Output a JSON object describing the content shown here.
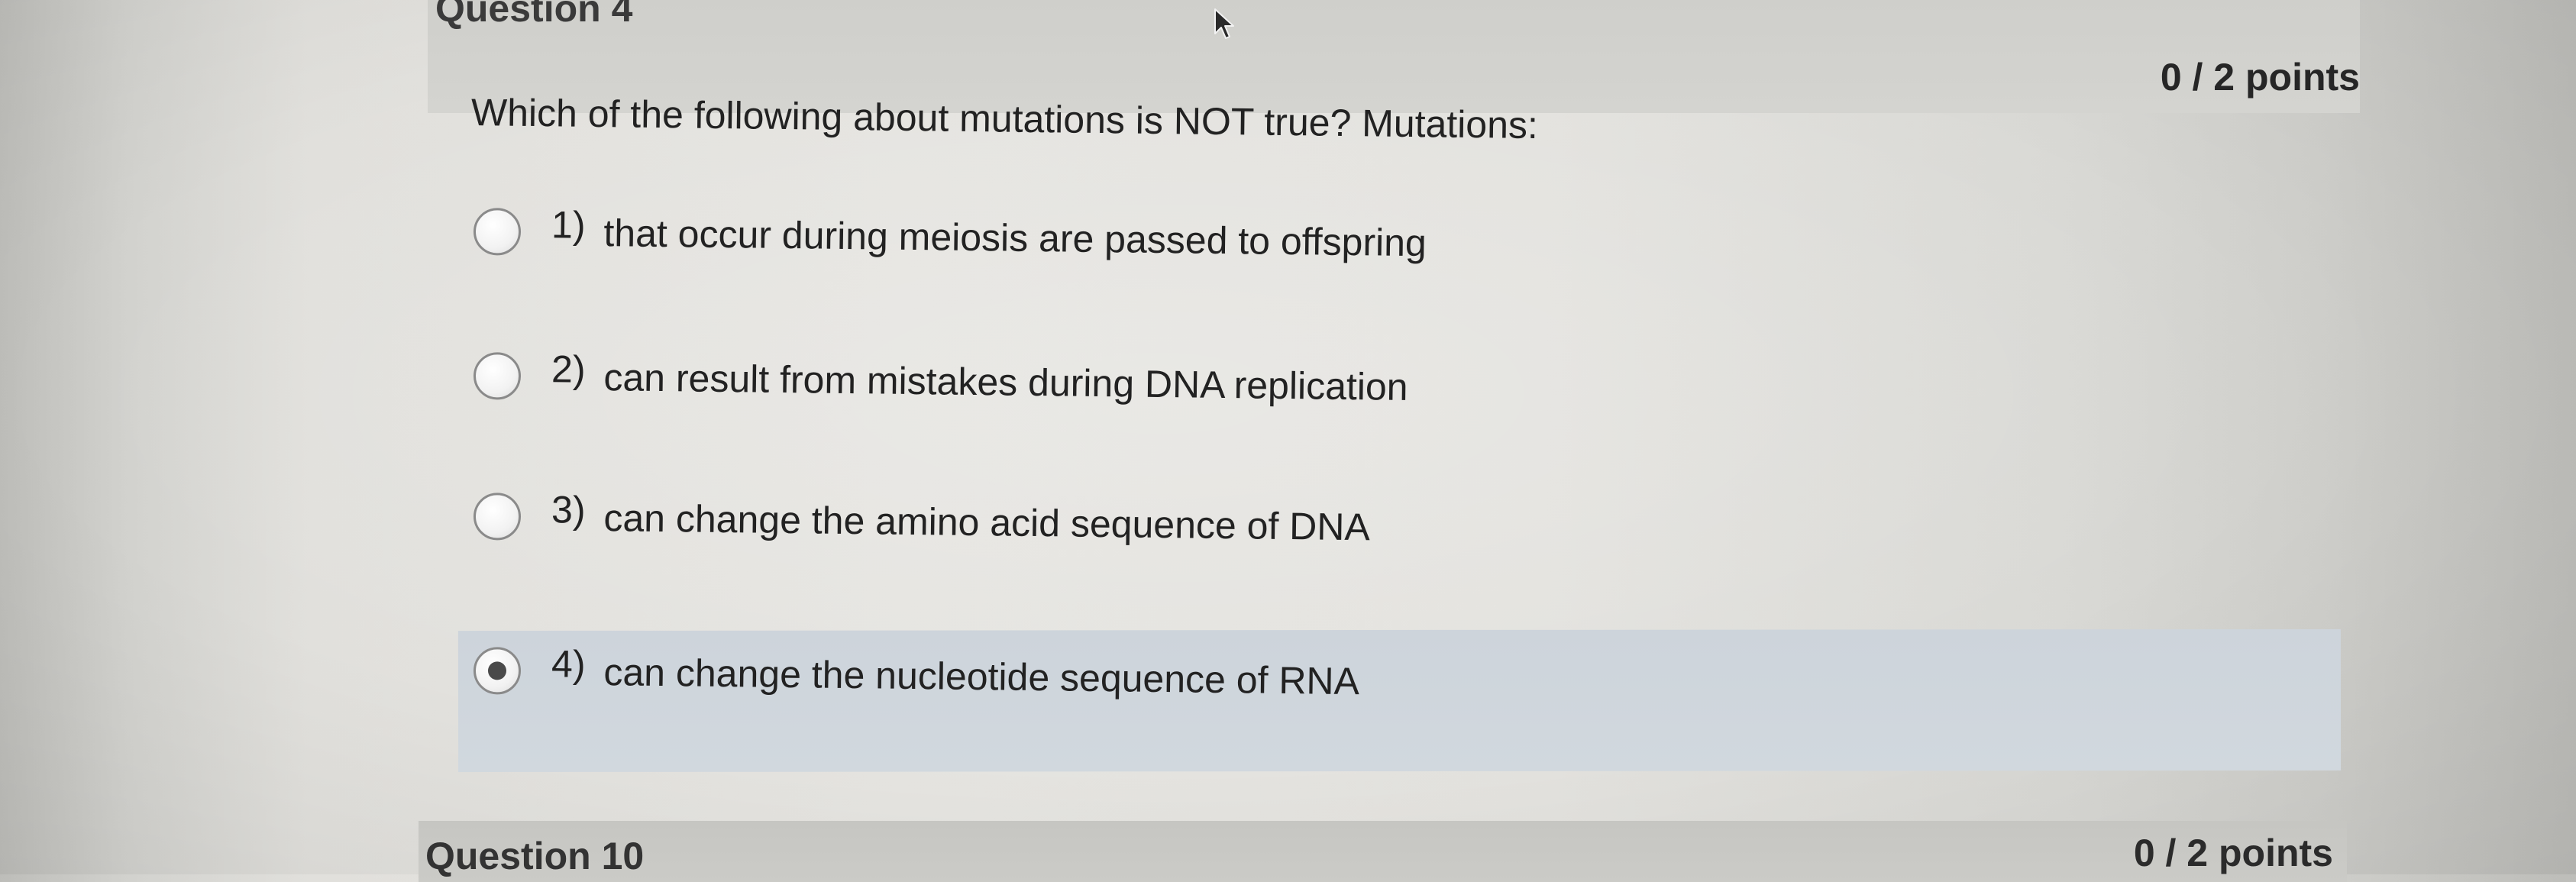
{
  "question": {
    "title": "Question 4",
    "points": "0 / 2 points",
    "prompt": "Which of the following about mutations is NOT true? Mutations:",
    "options": [
      {
        "number": "1)",
        "text": "that occur during meiosis are passed to offspring",
        "selected": false
      },
      {
        "number": "2)",
        "text": "can result from mistakes during DNA replication",
        "selected": false
      },
      {
        "number": "3)",
        "text": "can change the amino acid sequence of DNA",
        "selected": false
      },
      {
        "number": "4)",
        "text": "can change the nucleotide sequence of RNA",
        "selected": true
      }
    ]
  },
  "next_question": {
    "title": "Question 10",
    "points": "0 / 2 points"
  },
  "colors": {
    "header_bg": "#d1d1cd",
    "selected_bg": "#cfd6dc",
    "radio_dot": "#4a4a4a"
  },
  "icons": {
    "cursor": "mouse-pointer-icon"
  }
}
